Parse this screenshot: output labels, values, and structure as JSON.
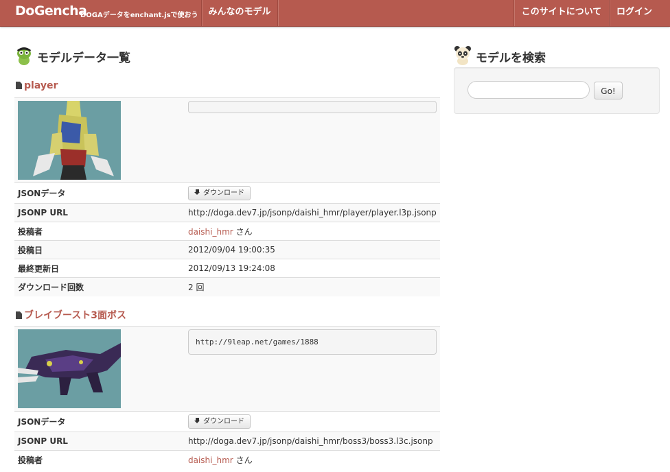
{
  "navbar": {
    "brand": "DoGencha",
    "tagline": "DOGAデータをenchant.jsで使おう",
    "nav_models": "みんなのモデル",
    "nav_about": "このサイトについて",
    "nav_login": "ログイン"
  },
  "main": {
    "heading": "モデルデータ一覧",
    "labels": {
      "json": "JSONデータ",
      "jsonp": "JSONP URL",
      "author": "投稿者",
      "posted": "投稿日",
      "updated": "最終更新日",
      "downloads": "ダウンロード回数"
    },
    "download_label": "ダウンロード",
    "models": [
      {
        "title": "player",
        "description": "",
        "jsonp_url": "http://doga.dev7.jp/jsonp/daishi_hmr/player/player.l3p.jsonp",
        "author": "daishi_hmr",
        "author_suffix": "さん",
        "posted": "2012/09/04 19:00:35",
        "updated": "2012/09/13 19:24:08",
        "download_count": "2 回"
      },
      {
        "title": "ブレイブースト3面ボス",
        "description": "http://9leap.net/games/1888",
        "jsonp_url": "http://doga.dev7.jp/jsonp/daishi_hmr/boss3/boss3.l3c.jsonp",
        "author": "daishi_hmr",
        "author_suffix": "さん"
      }
    ]
  },
  "search": {
    "heading": "モデルを検索",
    "input_value": "",
    "go_label": "Go!"
  },
  "colors": {
    "navbar": "#b65a4f",
    "link": "#b65a4f",
    "thumb_bg": "#6b9ea3"
  }
}
